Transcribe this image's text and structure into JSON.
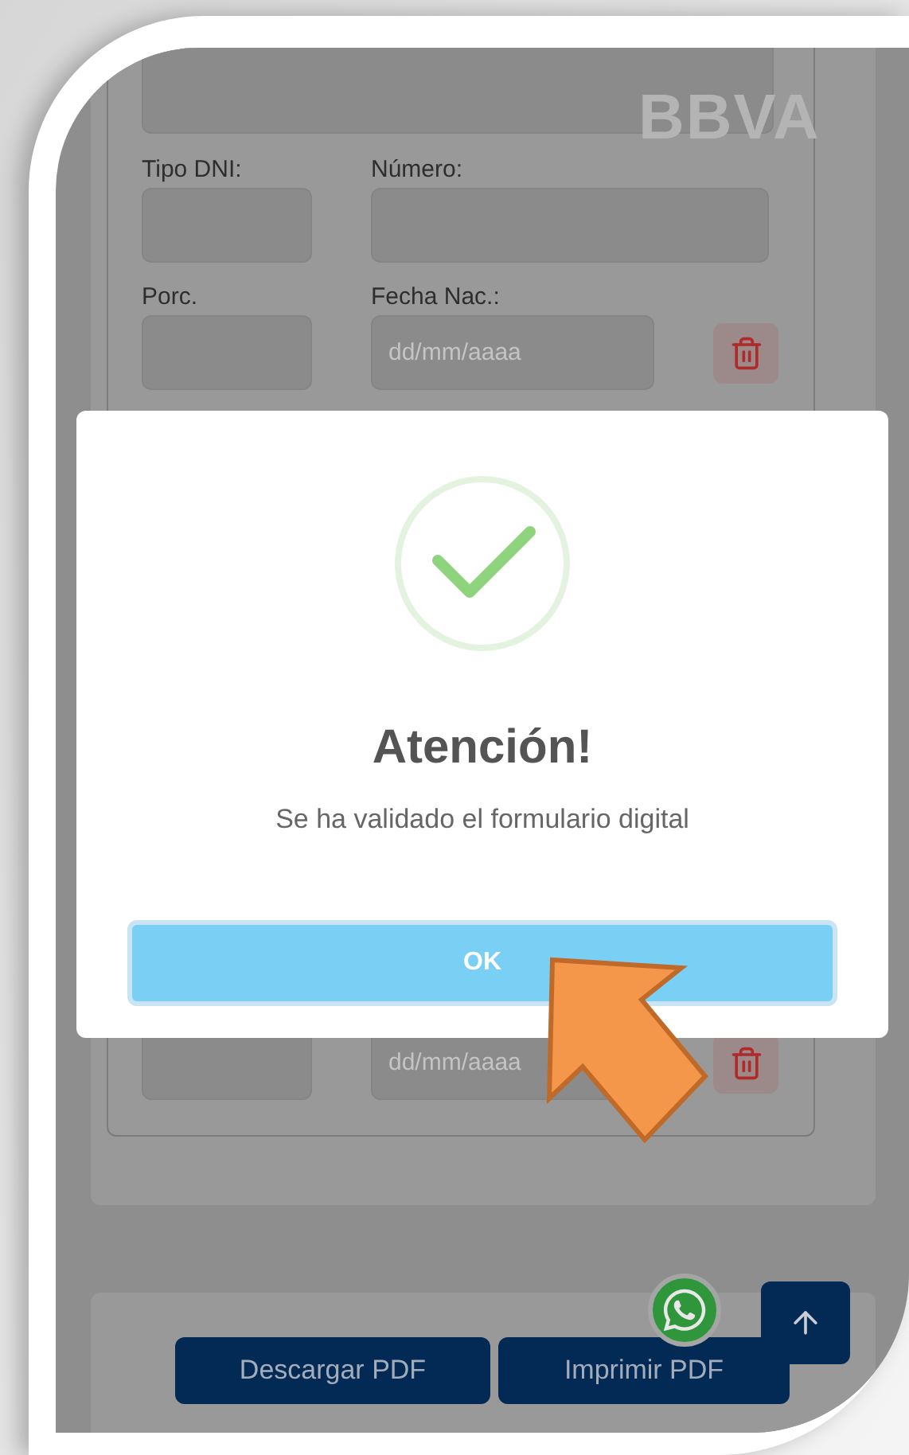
{
  "logo_text": "BBVA",
  "form": {
    "rows": [
      {
        "fields": [
          {
            "kind": "input",
            "label": "Tipo DNI:"
          },
          {
            "kind": "input",
            "label": "Número:"
          }
        ],
        "deletable": false
      },
      {
        "fields": [
          {
            "kind": "input",
            "label": "Porc."
          },
          {
            "kind": "input",
            "label": "Fecha Nac.:",
            "placeholder": "dd/mm/aaaa"
          }
        ],
        "deletable": true
      },
      {
        "fields": [
          {
            "kind": "input"
          },
          {
            "kind": "input",
            "placeholder": "dd/mm/aaaa"
          }
        ],
        "deletable": true
      }
    ]
  },
  "modal": {
    "title": "Atención!",
    "message": "Se ha validado el formulario digital",
    "button": "OK"
  },
  "actions": [
    "Descargar PDF",
    "Imprimir PDF"
  ]
}
